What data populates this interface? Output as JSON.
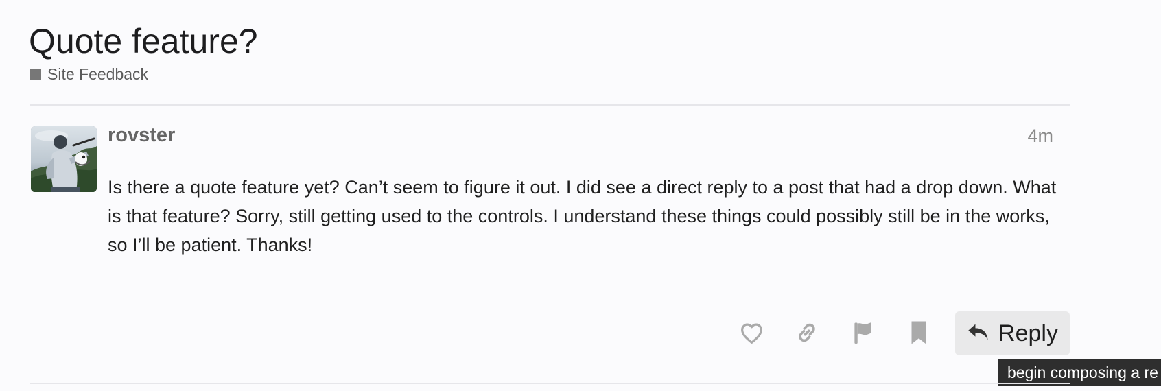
{
  "topic": {
    "title": "Quote feature?",
    "category": {
      "name": "Site Feedback",
      "color": "#777777"
    }
  },
  "post": {
    "username": "rovster",
    "date": "4m",
    "body": "Is there a quote feature yet? Can’t seem to figure it out. I did see a direct reply to a post that had a drop down. What is that feature? Sorry, still getting used to the controls. I understand these things could possibly still be in the works, so I’ll be patient. Thanks!"
  },
  "actions": {
    "like_icon": "heart-icon",
    "copy_link_icon": "link-icon",
    "flag_icon": "flag-icon",
    "bookmark_icon": "bookmark-icon",
    "reply_icon": "reply-arrow-icon",
    "reply_label": "Reply",
    "reply_tooltip": "begin composing a re"
  }
}
